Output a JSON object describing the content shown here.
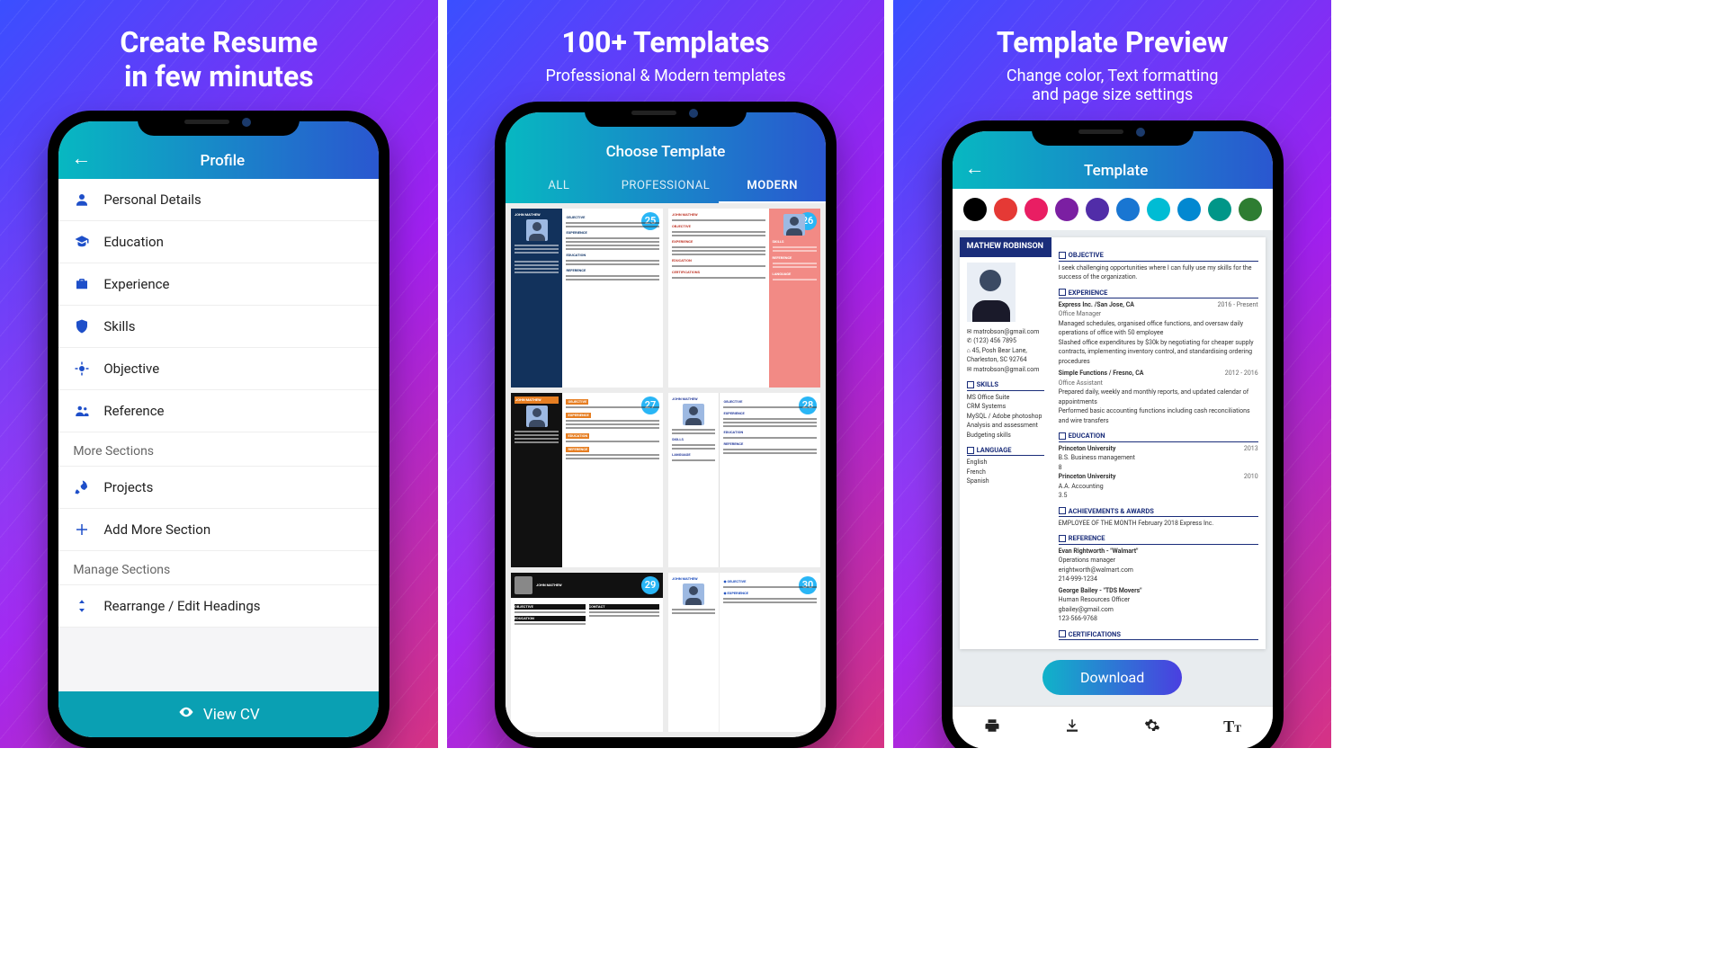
{
  "panels": {
    "p1": {
      "title_l1": "Create Resume",
      "title_l2": "in few minutes"
    },
    "p2": {
      "title": "100+ Templates",
      "sub": "Professional & Modern templates"
    },
    "p3": {
      "title": "Template Preview",
      "sub_l1": "Change color, Text formatting",
      "sub_l2": "and page size settings"
    }
  },
  "profile": {
    "bar_title": "Profile",
    "items": [
      {
        "label": "Personal Details"
      },
      {
        "label": "Education"
      },
      {
        "label": "Experience"
      },
      {
        "label": "Skills"
      },
      {
        "label": "Objective"
      },
      {
        "label": "Reference"
      }
    ],
    "more_label": "More Sections",
    "more_items": [
      {
        "label": "Projects"
      },
      {
        "label": "Add More Section"
      }
    ],
    "manage_label": "Manage Sections",
    "manage_items": [
      {
        "label": "Rearrange / Edit Headings"
      }
    ],
    "view_cv": "View  CV"
  },
  "choose": {
    "bar_title": "Choose Template",
    "tabs": {
      "all": "ALL",
      "pro": "PROFESSIONAL",
      "modern": "MODERN"
    },
    "sample_name": "JOHN MATHEW",
    "badges": [
      "25",
      "26",
      "27",
      "28",
      "29",
      "30"
    ]
  },
  "preview": {
    "bar_title": "Template",
    "colors": [
      "#000000",
      "#e53935",
      "#e91e63",
      "#7b1fa2",
      "#512da8",
      "#1976d2",
      "#00bcd4",
      "#0288d1",
      "#009688",
      "#2e7d32"
    ],
    "download": "Download",
    "resume": {
      "name": "MATHEW ROBINSON",
      "contact": {
        "email": "matrobson@gmail.com",
        "phone": "(123) 456 7895",
        "addr": "45, Posh Bear Lane, Charleston, SC 92764",
        "email2": "matrobson@gmail.com"
      },
      "skills_h": "SKILLS",
      "skills": [
        "MS Office Suite",
        "CRM Systems",
        "MySQL / Adobe photoshop",
        "Analysis and assessment",
        "Budgeting skills"
      ],
      "lang_h": "LANGUAGE",
      "langs": [
        "English",
        "French",
        "Spanish"
      ],
      "obj_h": "OBJECTIVE",
      "objective": "I seek challenging opportunities where I can fully use my skills for the success of the organization.",
      "exp_h": "EXPERIENCE",
      "exp": [
        {
          "org": "Express Inc. /San Jose, CA",
          "dates": "2016 - Present",
          "role": "Office Manager",
          "b1": "Managed schedules, organised office functions, and oversaw daily operations of office with 50 employee",
          "b2": "Slashed office expenditures by $30k by negotiating for cheaper supply contracts, implementing inventory control, and standardising ordering procedures"
        },
        {
          "org": "Simple Functions / Fresno, CA",
          "dates": "2012 - 2016",
          "role": "Office Assistant",
          "b1": "Prepared daily, weekly and monthly reports, and updated calendar of appointments",
          "b2": "Performed basic accounting functions including cash reconciliations and wire transfers"
        }
      ],
      "edu_h": "EDUCATION",
      "edu": [
        {
          "school": "Princeton University",
          "year": "2013",
          "deg": "B.S. Business management",
          "gpa": "8"
        },
        {
          "school": "Princeton University",
          "year": "2010",
          "deg": "A.A. Accounting",
          "gpa": "3.5"
        }
      ],
      "ach_h": "ACHIEVEMENTS & AWARDS",
      "ach": "EMPLOYEE OF THE MONTH February 2018 Express Inc.",
      "ref_h": "REFERENCE",
      "refs": [
        {
          "n": "Evan Rightworth - \"Walmart\"",
          "t": "Operations manager",
          "e": "erightworth@walmart.com",
          "p": "214-999-1234"
        },
        {
          "n": "George Bailey - \"TDS Movers\"",
          "t": "Human Resources Officer",
          "e": "gbailey@gmail.com",
          "p": "123-566-9768"
        }
      ],
      "cert_h": "CERTIFICATIONS"
    }
  }
}
